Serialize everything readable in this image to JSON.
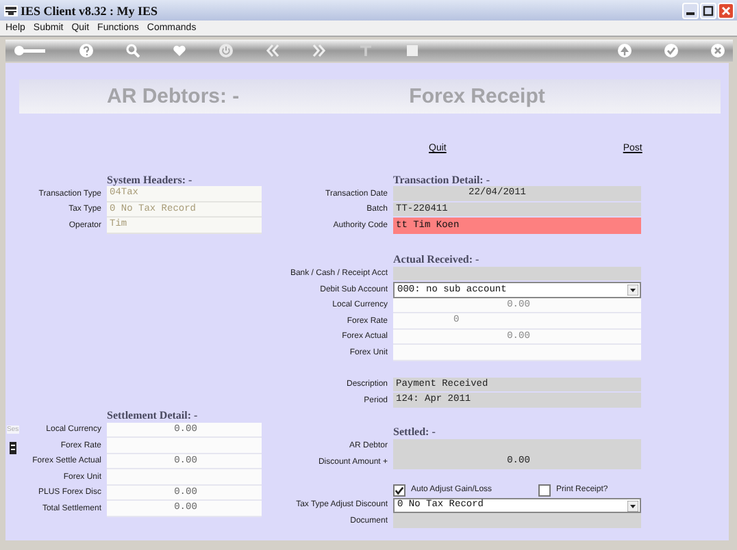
{
  "window": {
    "title": "IES Client v8.32 : My IES"
  },
  "menu": [
    "Help",
    "Submit",
    "Quit",
    "Functions",
    "Commands"
  ],
  "banner": {
    "module": "AR Debtors: -",
    "screen": "Forex Receipt"
  },
  "links": [
    "Quit",
    "Post"
  ],
  "side_tab": "Ses",
  "left_sections": [
    {
      "title": "System Headers: -",
      "rows": [
        {
          "label": "Transaction Type",
          "value": "04Tax",
          "kind": "text"
        },
        {
          "label": "Tax Type",
          "value": "0 No Tax Record",
          "kind": "text"
        },
        {
          "label": "Operator",
          "value": "Tim",
          "kind": "text"
        }
      ]
    },
    {
      "title": "Settlement Detail: -",
      "rows": [
        {
          "label": "Local Currency",
          "value": "0.00",
          "kind": "amount"
        },
        {
          "label": "Forex Rate",
          "kind": "amount"
        },
        {
          "label": "Forex Settle Actual",
          "value": "0.00",
          "kind": "amount"
        },
        {
          "label": "Forex Unit",
          "kind": "amount"
        },
        {
          "label": "PLUS Forex Disc",
          "value": "0.00",
          "kind": "amount"
        },
        {
          "label": "Total Settlement",
          "value": "0.00",
          "kind": "amount"
        }
      ]
    }
  ],
  "right_sections": [
    {
      "title": "Transaction Detail: -",
      "rows": [
        {
          "label": "Transaction Date",
          "value": "22/04/2011",
          "kind": "date"
        },
        {
          "label": "Batch",
          "value": "TT-220411",
          "kind": "grey"
        },
        {
          "label": "Authority Code",
          "value": "tt Tim Koen",
          "kind": "alert"
        }
      ]
    },
    {
      "title": "Actual Received: -",
      "rows": [
        {
          "label": "Bank / Cash / Receipt Acct",
          "kind": "grey"
        },
        {
          "label": "Debit Sub Account",
          "value": "000: no sub account",
          "kind": "dropdown"
        },
        {
          "label": "Local Currency",
          "value": "0.00",
          "kind": "amount"
        },
        {
          "label": "Forex Rate",
          "value": "0",
          "kind": "rate"
        },
        {
          "label": "Forex Actual",
          "value": "0.00",
          "kind": "amount"
        },
        {
          "label": "Forex Unit",
          "kind": "amount"
        }
      ]
    },
    {
      "rows": [
        {
          "label": "Description",
          "value": "Payment Received",
          "kind": "grey"
        },
        {
          "label": "Period",
          "value": "124: Apr 2011",
          "kind": "grey"
        }
      ]
    },
    {
      "title": "Settled: -",
      "rows": [
        {
          "label": "AR Debtor",
          "kind": "greytop"
        },
        {
          "label": "Discount Amount +",
          "value": "0.00",
          "kind": "greyamount"
        }
      ]
    },
    {
      "checkboxes": [
        {
          "label": "Auto Adjust Gain/Loss",
          "checked": true
        },
        {
          "label": "Print Receipt?",
          "checked": false
        }
      ],
      "rows": [
        {
          "label": "Tax Type Adjust Discount",
          "value": "0 No Tax Record",
          "kind": "dropdown"
        },
        {
          "label": "Document",
          "kind": "grey"
        }
      ]
    }
  ]
}
